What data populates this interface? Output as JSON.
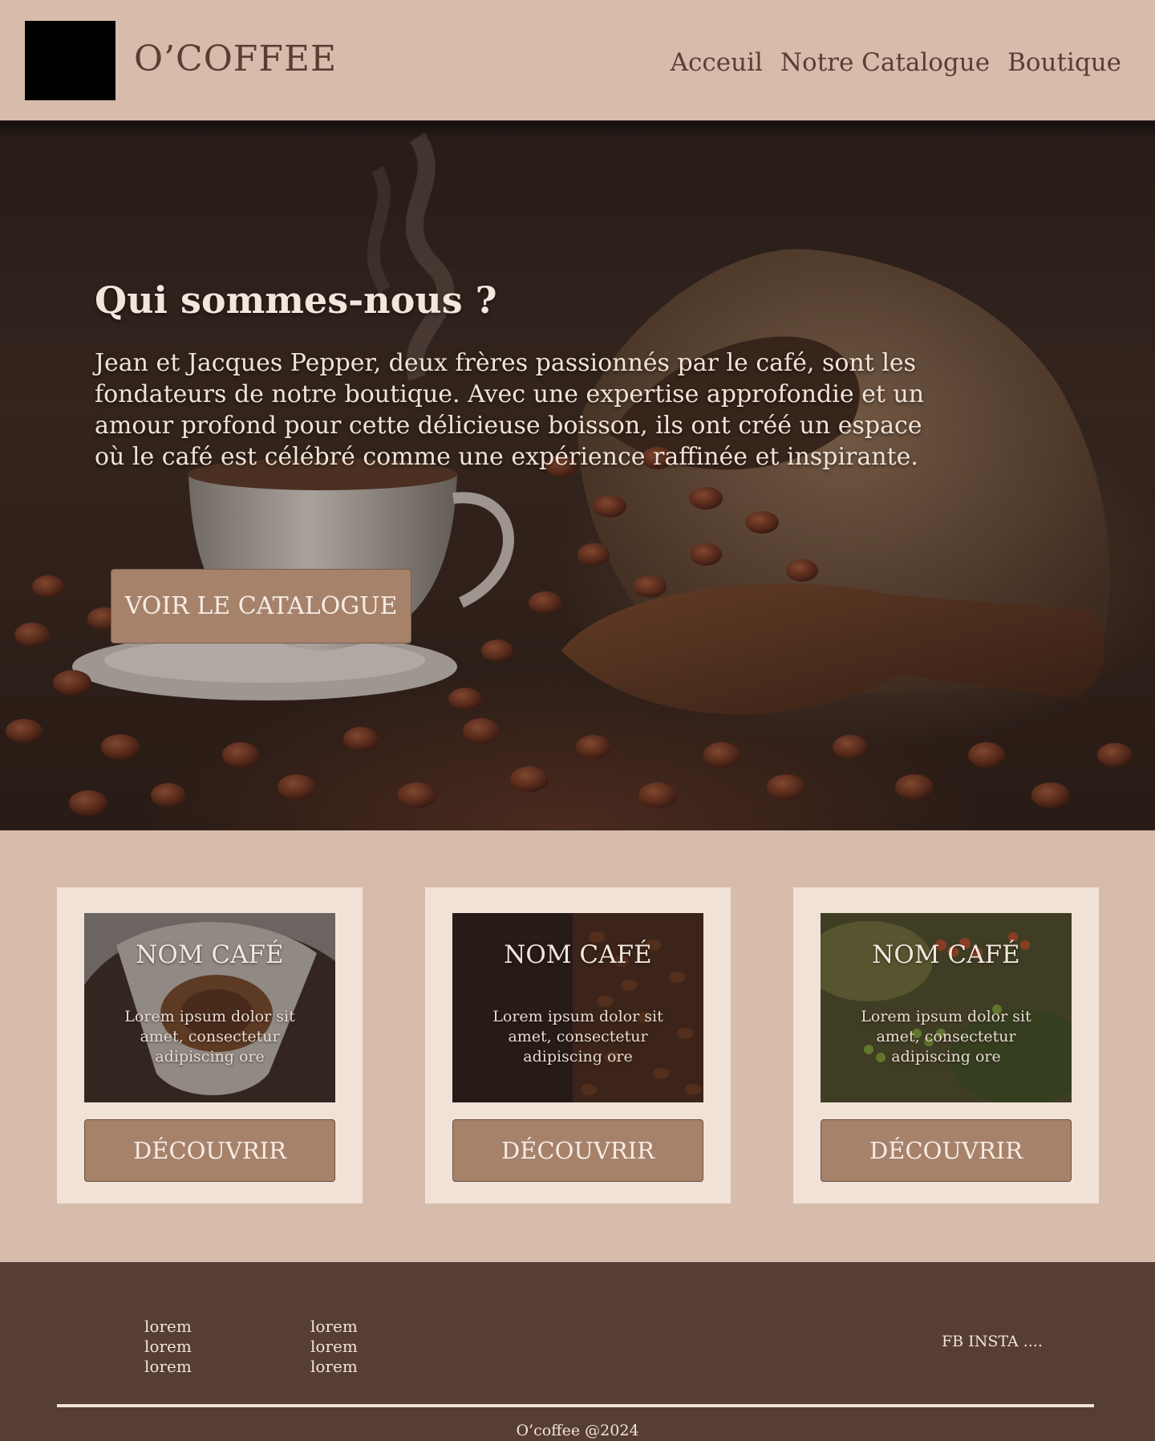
{
  "header": {
    "brand": "O’COFFEE",
    "nav": [
      {
        "label": "Acceuil"
      },
      {
        "label": "Notre Catalogue"
      },
      {
        "label": "Boutique"
      }
    ]
  },
  "hero": {
    "title": "Qui sommes-nous ?",
    "text": "Jean et Jacques Pepper, deux frères passionnés par le café, sont les fondateurs de notre boutique. Avec une expertise approfondie et un amour profond pour cette délicieuse boisson, ils ont créé un espace où le café est célébré comme une expérience raffinée et inspirante.",
    "button_label": "VOIR LE CATALOGUE"
  },
  "cards": [
    {
      "title": "NOM CAFÉ",
      "text": "Lorem ipsum dolor sit amet, consectetur adipiscing ore",
      "button_label": "DÉCOUVRIR"
    },
    {
      "title": "NOM CAFÉ",
      "text": "Lorem ipsum dolor sit amet, consectetur adipiscing ore",
      "button_label": "DÉCOUVRIR"
    },
    {
      "title": "NOM CAFÉ",
      "text": "Lorem ipsum dolor sit amet, consectetur adipiscing ore",
      "button_label": "DÉCOUVRIR"
    }
  ],
  "footer": {
    "col1": [
      "lorem",
      "lorem",
      "lorem"
    ],
    "col2": [
      "lorem",
      "lorem",
      "lorem"
    ],
    "social": "FB INSTA ....",
    "copyright": "O’coffee @2024"
  },
  "colors": {
    "background": "#d7bcab",
    "text_brown": "#5a3e34",
    "button": "#a7826b",
    "card_background": "#f1e2d8",
    "footer_background": "#573e35",
    "logo_placeholder": "#000000"
  }
}
